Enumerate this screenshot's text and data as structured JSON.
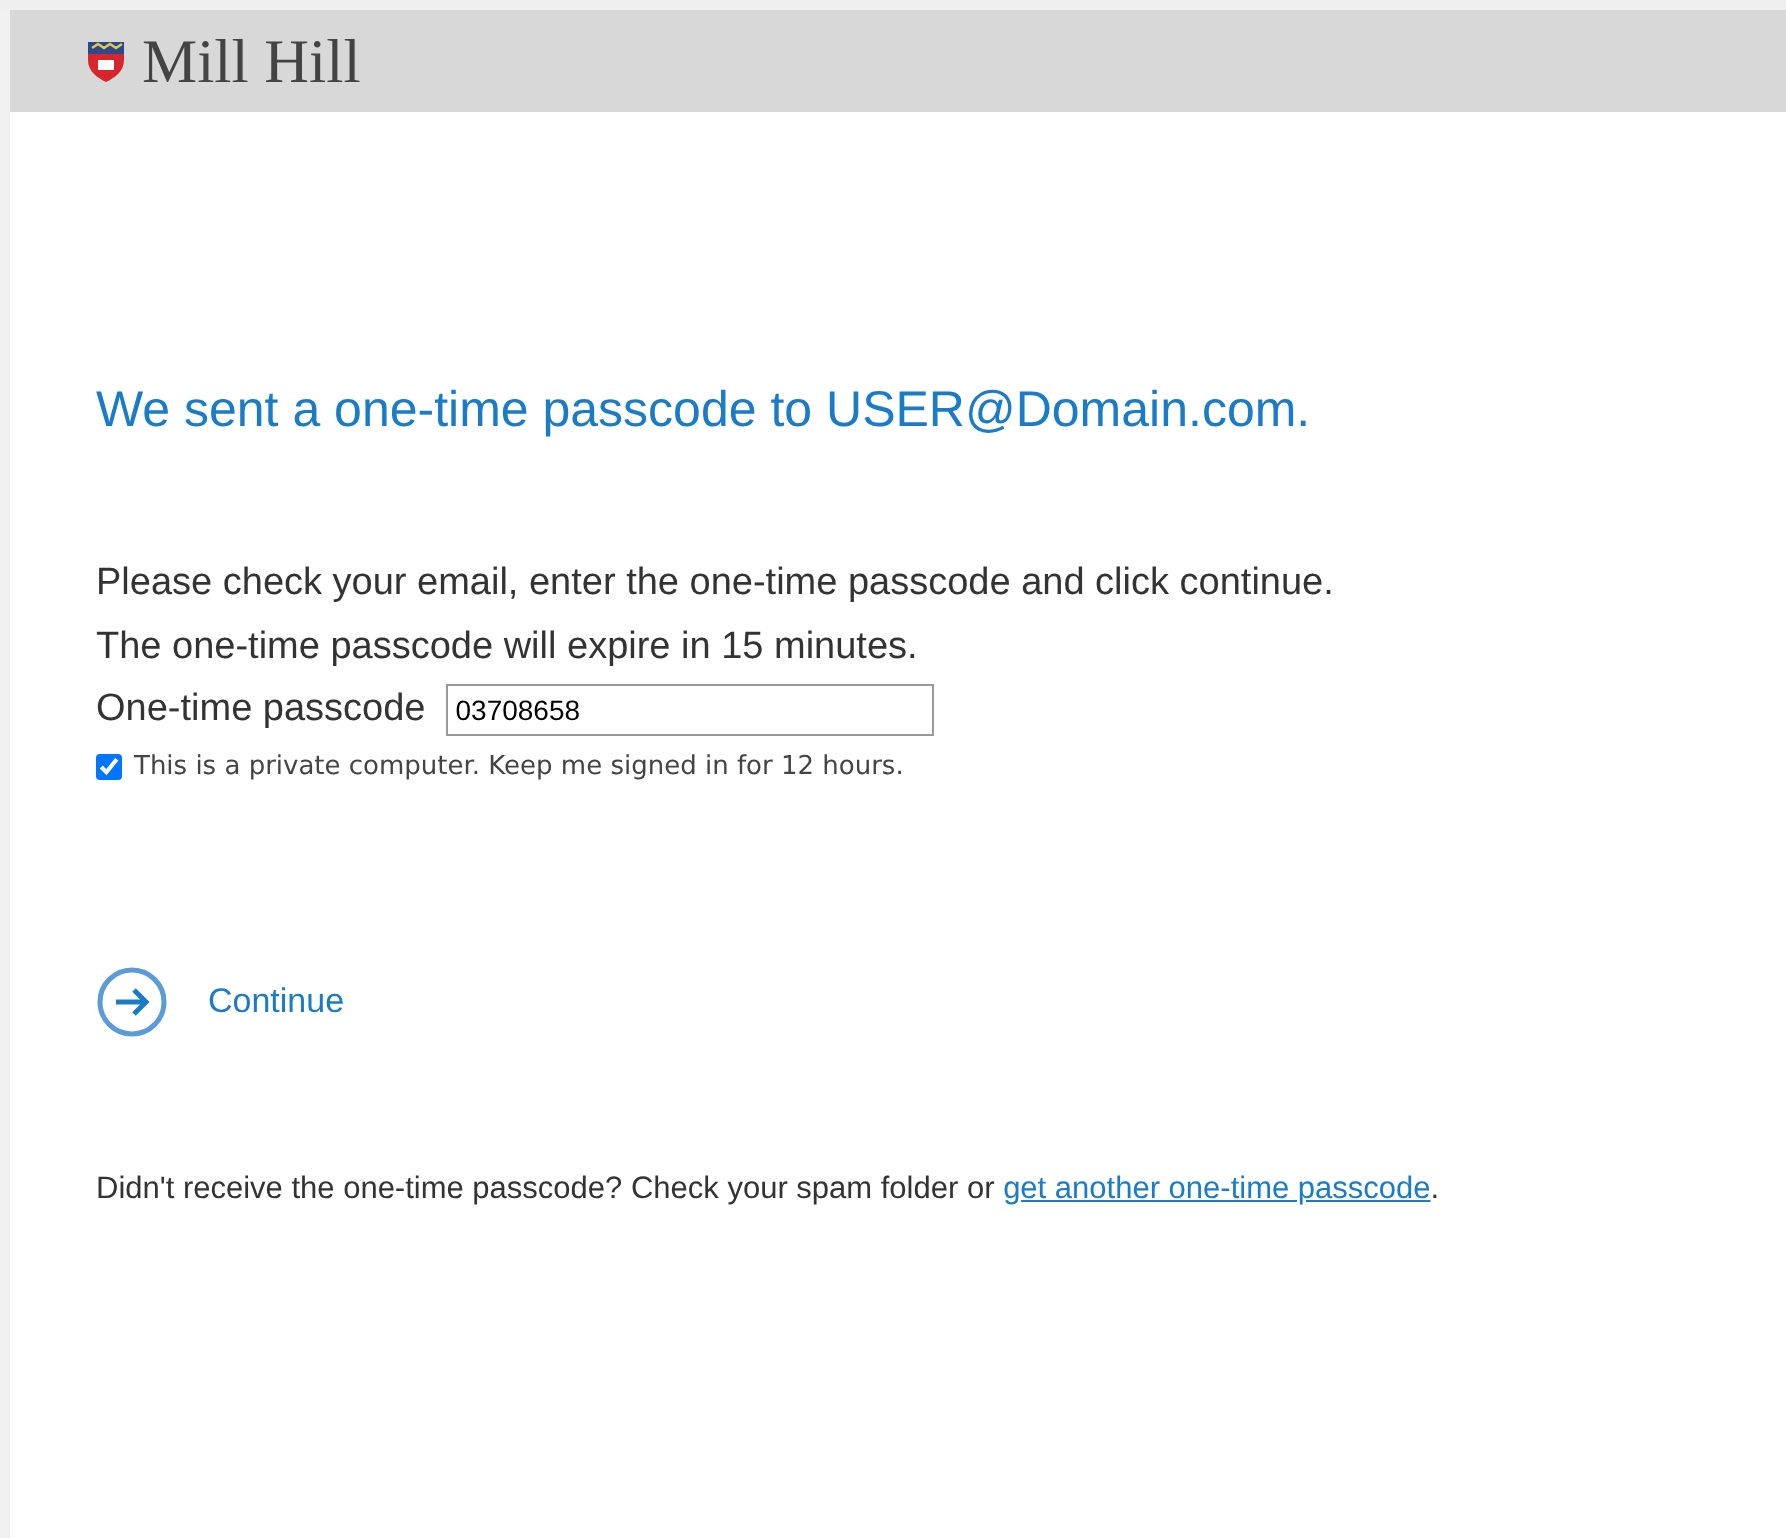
{
  "header": {
    "logo_text": "Mill Hill"
  },
  "heading": "We sent a one-time passcode to USER@Domain.com.",
  "instructions": [
    "Please check your email, enter the one-time passcode and click continue.",
    "The one-time passcode will expire in 15 minutes."
  ],
  "passcode_field": {
    "label": "One-time passcode",
    "value": "03708658"
  },
  "keep_signed_in": {
    "label": "This is a private computer. Keep me signed in for 12 hours.",
    "checked": true
  },
  "continue_button": {
    "label": "Continue"
  },
  "footer": {
    "text": "Didn't receive the one-time passcode? Check your spam folder or",
    "link": "get another one-time passcode",
    "end": "."
  }
}
